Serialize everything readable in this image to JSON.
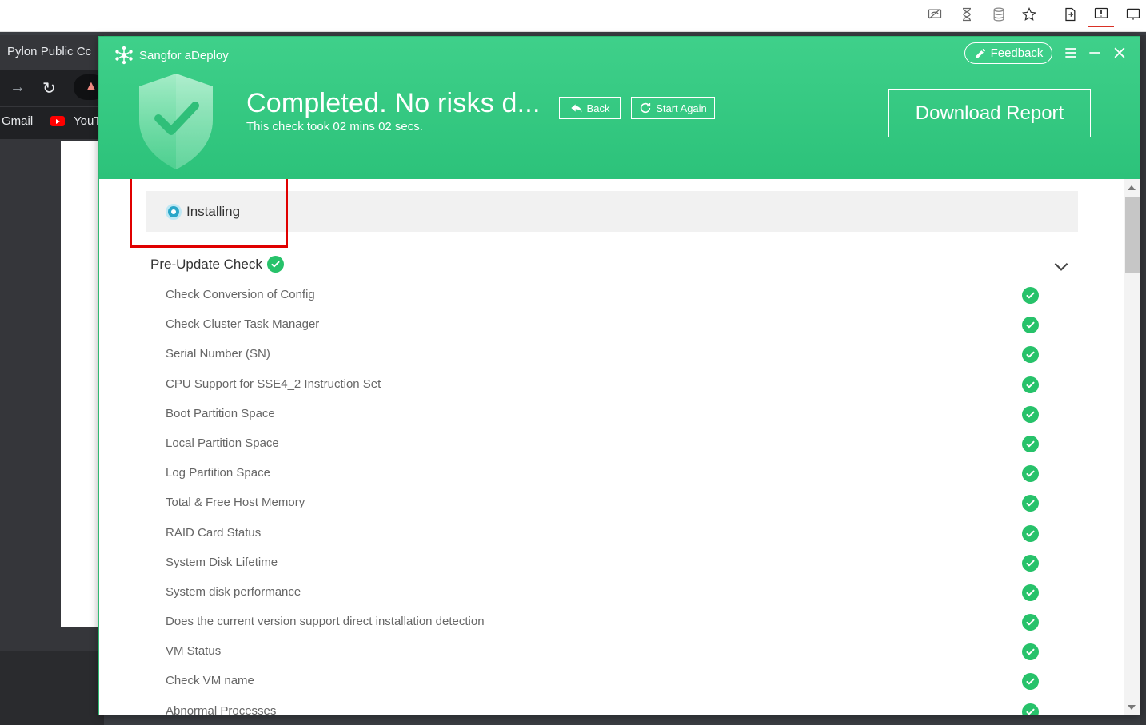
{
  "browser": {
    "tab_title": "Pylon Public Cc",
    "bookmarks": [
      "Gmail",
      "YouT"
    ]
  },
  "app": {
    "brand": "Sangfor aDeploy",
    "feedback_label": "Feedback",
    "status_title": "Completed. No risks d...",
    "status_subtitle": "This check took 02 mins 02 secs.",
    "back_label": "Back",
    "start_again_label": "Start Again",
    "download_label": "Download Report",
    "accent_color": "#2cc27a"
  },
  "install": {
    "label": "Installing"
  },
  "section": {
    "title": "Pre-Update Check",
    "items": [
      {
        "label": "Check Conversion of Config"
      },
      {
        "label": "Check Cluster Task Manager"
      },
      {
        "label": "Serial Number (SN)"
      },
      {
        "label": "CPU Support for SSE4_2 Instruction Set"
      },
      {
        "label": "Boot Partition Space"
      },
      {
        "label": "Local Partition Space"
      },
      {
        "label": "Log Partition Space"
      },
      {
        "label": "Total & Free Host Memory"
      },
      {
        "label": "RAID Card Status"
      },
      {
        "label": "System Disk Lifetime"
      },
      {
        "label": "System disk performance"
      },
      {
        "label": "Does the current version support direct installation detection"
      },
      {
        "label": "VM Status"
      },
      {
        "label": "Check VM name"
      },
      {
        "label": "Abnormal Processes"
      }
    ]
  }
}
